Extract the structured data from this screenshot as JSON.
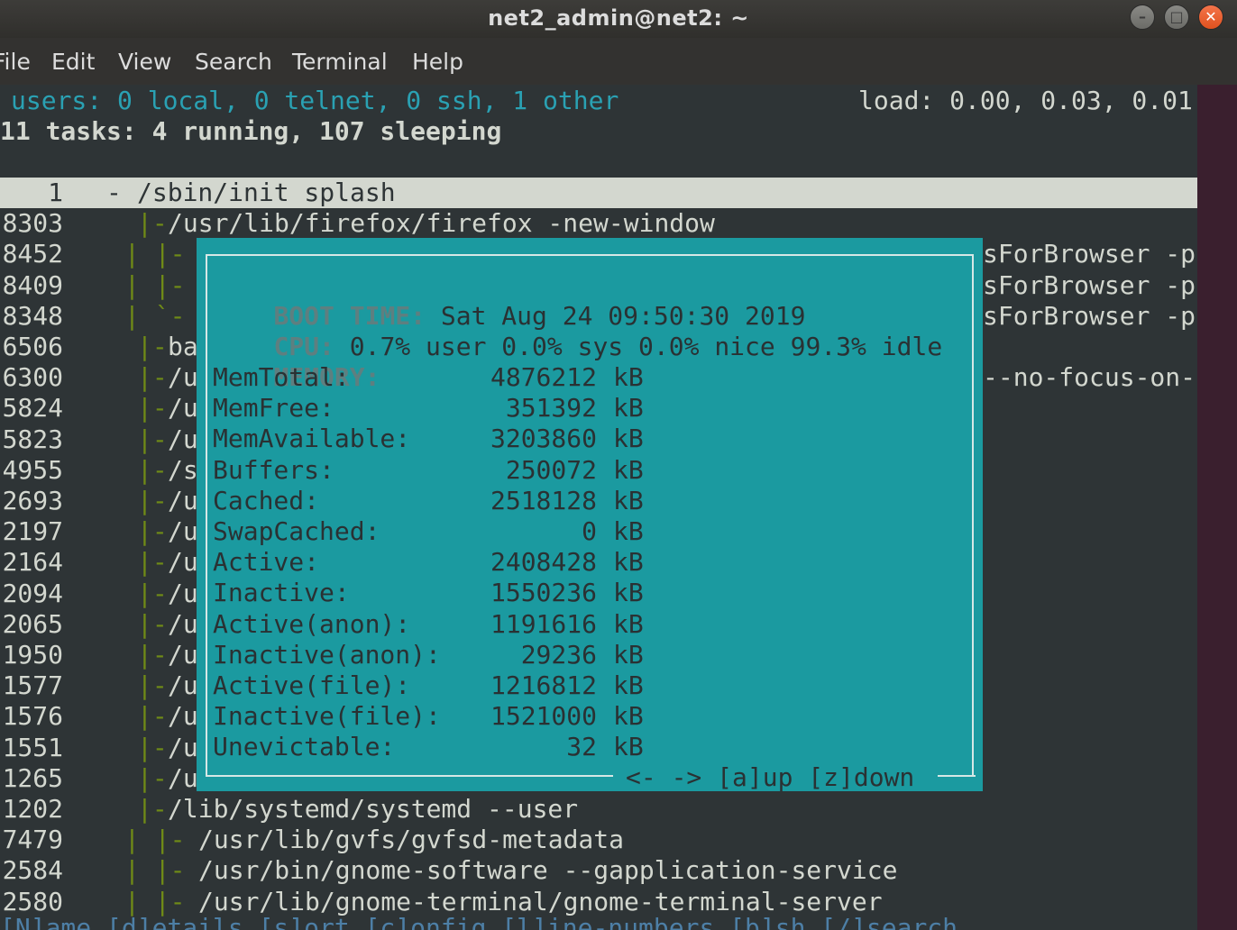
{
  "window": {
    "title": "net2_admin@net2: ~",
    "buttons": {
      "minimize": "–",
      "maximize": "□",
      "close": "✕"
    }
  },
  "menu": [
    "File",
    "Edit",
    "View",
    "Search",
    "Terminal",
    "Help"
  ],
  "header": {
    "users": "users: 0 local, 0 telnet, 0 ssh, 1 other",
    "load": "load: 0.00, 0.03, 0.01",
    "tasks": "11 tasks: 4 running, 107 sleeping"
  },
  "processes": [
    {
      "pid": "1",
      "tree": "-",
      "cmd": "/sbin/init splash",
      "tail": ""
    },
    {
      "pid": "8303",
      "tree": "|-",
      "cmd": "/usr/lib/firefox/firefox -new-window",
      "tail": ""
    },
    {
      "pid": "8452",
      "tree": "| |-",
      "cmd": "",
      "tail": "sForBrowser -p"
    },
    {
      "pid": "8409",
      "tree": "| |-",
      "cmd": "",
      "tail": "sForBrowser -p"
    },
    {
      "pid": "8348",
      "tree": "| `-",
      "cmd": "",
      "tail": "sForBrowser -p"
    },
    {
      "pid": "6506",
      "tree": "|-",
      "cmd": "ba",
      "tail": ""
    },
    {
      "pid": "6300",
      "tree": "|-",
      "cmd": "/u",
      "tail": "--no-focus-on-"
    },
    {
      "pid": "5824",
      "tree": "|-",
      "cmd": "/u",
      "tail": ""
    },
    {
      "pid": "5823",
      "tree": "|-",
      "cmd": "/u",
      "tail": ""
    },
    {
      "pid": "4955",
      "tree": "|-",
      "cmd": "/s",
      "tail": ""
    },
    {
      "pid": "2693",
      "tree": "|-",
      "cmd": "/u",
      "tail": ""
    },
    {
      "pid": "2197",
      "tree": "|-",
      "cmd": "/u",
      "tail": ""
    },
    {
      "pid": "2164",
      "tree": "|-",
      "cmd": "/u",
      "tail": ""
    },
    {
      "pid": "2094",
      "tree": "|-",
      "cmd": "/u",
      "tail": ""
    },
    {
      "pid": "2065",
      "tree": "|-",
      "cmd": "/u",
      "tail": ""
    },
    {
      "pid": "1950",
      "tree": "|-",
      "cmd": "/u",
      "tail": ""
    },
    {
      "pid": "1577",
      "tree": "|-",
      "cmd": "/u",
      "tail": ""
    },
    {
      "pid": "1576",
      "tree": "|-",
      "cmd": "/u",
      "tail": ""
    },
    {
      "pid": "1551",
      "tree": "|-",
      "cmd": "/u",
      "tail": ""
    },
    {
      "pid": "1265",
      "tree": "|-",
      "cmd": "/u",
      "tail": ""
    },
    {
      "pid": "1202",
      "tree": "|-",
      "cmd": "/lib/systemd/systemd --user",
      "tail": ""
    },
    {
      "pid": "7479",
      "tree": "| |-",
      "cmd": "/usr/lib/gvfs/gvfsd-metadata",
      "tail": ""
    },
    {
      "pid": "2584",
      "tree": "| |-",
      "cmd": "/usr/bin/gnome-software --gapplication-service",
      "tail": ""
    },
    {
      "pid": "2580",
      "tree": "| |-",
      "cmd": "/usr/lib/gnome-terminal/gnome-terminal-server",
      "tail": ""
    }
  ],
  "popup": {
    "boot_label": "BOOT TIME:",
    "boot_value": "Sat Aug 24 09:50:30 2019",
    "cpu_label": "CPU:",
    "cpu_value": "0.7% user 0.0% sys 0.0% nice 99.3% idle",
    "memory_label": "MEMORY:",
    "unit": "kB",
    "mem": [
      {
        "label": "MemTotal:",
        "value": "4876212"
      },
      {
        "label": "MemFree:",
        "value": "351392"
      },
      {
        "label": "MemAvailable:",
        "value": "3203860"
      },
      {
        "label": "Buffers:",
        "value": "250072"
      },
      {
        "label": "Cached:",
        "value": "2518128"
      },
      {
        "label": "SwapCached:",
        "value": "0"
      },
      {
        "label": "Active:",
        "value": "2408428"
      },
      {
        "label": "Inactive:",
        "value": "1550236"
      },
      {
        "label": "Active(anon):",
        "value": "1191616"
      },
      {
        "label": "Inactive(anon):",
        "value": "29236"
      },
      {
        "label": "Active(file):",
        "value": "1216812"
      },
      {
        "label": "Inactive(file):",
        "value": "1521000"
      },
      {
        "label": "Unevictable:",
        "value": "32"
      }
    ],
    "footer": "<- -> [a]up [z]down"
  },
  "status_line": "[N]ame [d]etails [s]ort [c]onfig [l]ine-numbers [b]sh [/]search"
}
